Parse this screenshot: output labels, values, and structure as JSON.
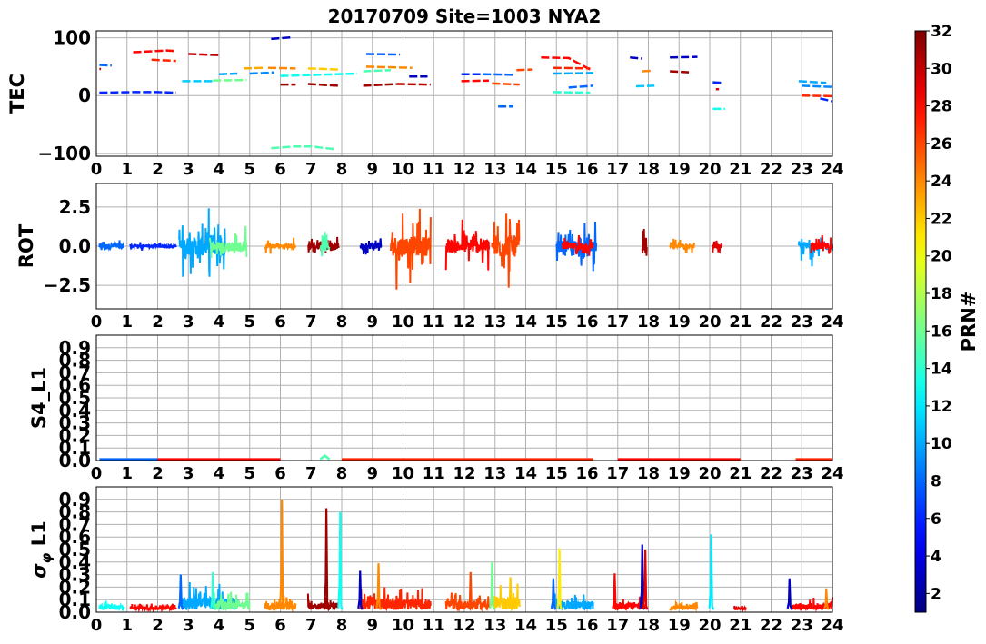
{
  "title": "20170709 Site=1003 NYA2",
  "x_ticks": [
    "0",
    "1",
    "2",
    "3",
    "4",
    "5",
    "6",
    "7",
    "8",
    "9",
    "10",
    "11",
    "12",
    "13",
    "14",
    "15",
    "16",
    "17",
    "18",
    "19",
    "20",
    "21",
    "22",
    "23",
    "24"
  ],
  "colorbar": {
    "label": "PRN#",
    "range": [
      1,
      32
    ],
    "ticks": [
      "2",
      "4",
      "6",
      "8",
      "10",
      "12",
      "14",
      "16",
      "18",
      "20",
      "22",
      "24",
      "26",
      "28",
      "30",
      "32"
    ],
    "colormap": "jet"
  },
  "chart_data": [
    {
      "type": "line",
      "ylabel": "TEC",
      "xlim": [
        0,
        24
      ],
      "ylim": [
        -105,
        112
      ],
      "yticks": [
        "100",
        "0",
        "−100"
      ],
      "ytick_values": [
        100,
        0,
        -100
      ],
      "grid": true,
      "segments": [
        {
          "prn": 8,
          "x": [
            0.1,
            0.5
          ],
          "y": [
            53,
            52
          ]
        },
        {
          "prn": 6,
          "x": [
            0.1,
            1.2,
            2.0,
            2.6
          ],
          "y": [
            5,
            6,
            6,
            5
          ]
        },
        {
          "prn": 30,
          "x": [
            0.1,
            0.15
          ],
          "y": [
            46,
            46
          ]
        },
        {
          "prn": 28,
          "x": [
            1.2,
            2.3,
            2.6
          ],
          "y": [
            75,
            78,
            77
          ]
        },
        {
          "prn": 27,
          "x": [
            1.8,
            2.6
          ],
          "y": [
            62,
            60
          ]
        },
        {
          "prn": 30,
          "x": [
            3.0,
            4.0
          ],
          "y": [
            72,
            70
          ]
        },
        {
          "prn": 11,
          "x": [
            2.8,
            3.8
          ],
          "y": [
            25,
            25
          ]
        },
        {
          "prn": 16,
          "x": [
            3.8,
            4.9
          ],
          "y": [
            26,
            27
          ]
        },
        {
          "prn": 10,
          "x": [
            4.0,
            4.6
          ],
          "y": [
            37,
            38
          ]
        },
        {
          "prn": 23,
          "x": [
            4.8,
            5.5
          ],
          "y": [
            47,
            48
          ]
        },
        {
          "prn": 9,
          "x": [
            5.0,
            5.8
          ],
          "y": [
            38,
            40
          ]
        },
        {
          "prn": 24,
          "x": [
            5.6,
            6.5
          ],
          "y": [
            48,
            47
          ]
        },
        {
          "prn": 3,
          "x": [
            5.7,
            6.4
          ],
          "y": [
            98,
            101
          ]
        },
        {
          "prn": 15,
          "x": [
            5.7,
            6.5,
            7.0,
            7.8
          ],
          "y": [
            -91,
            -88,
            -88,
            -93
          ]
        },
        {
          "prn": 31,
          "x": [
            6.0,
            6.5
          ],
          "y": [
            19,
            19
          ]
        },
        {
          "prn": 22,
          "x": [
            6.9,
            7.9
          ],
          "y": [
            47,
            45
          ]
        },
        {
          "prn": 31,
          "x": [
            6.9,
            7.9
          ],
          "y": [
            20,
            17
          ]
        },
        {
          "prn": 13,
          "x": [
            6.0,
            8.5
          ],
          "y": [
            34,
            38
          ]
        },
        {
          "prn": 8,
          "x": [
            8.8,
            9.9
          ],
          "y": [
            72,
            71
          ]
        },
        {
          "prn": 24,
          "x": [
            8.8,
            10.3
          ],
          "y": [
            50,
            48
          ]
        },
        {
          "prn": 15,
          "x": [
            8.7,
            9.6
          ],
          "y": [
            42,
            44
          ]
        },
        {
          "prn": 31,
          "x": [
            8.7,
            9.8
          ],
          "y": [
            17,
            20
          ]
        },
        {
          "prn": 30,
          "x": [
            9.8,
            10.9
          ],
          "y": [
            20,
            19
          ]
        },
        {
          "prn": 3,
          "x": [
            10.2,
            10.8
          ],
          "y": [
            33,
            33
          ]
        },
        {
          "prn": 6,
          "x": [
            11.9,
            12.7
          ],
          "y": [
            37,
            37
          ]
        },
        {
          "prn": 28,
          "x": [
            11.9,
            12.8
          ],
          "y": [
            25,
            26
          ]
        },
        {
          "prn": 26,
          "x": [
            12.9,
            13.8
          ],
          "y": [
            21,
            19
          ]
        },
        {
          "prn": 8,
          "x": [
            12.6,
            13.6
          ],
          "y": [
            37,
            36
          ]
        },
        {
          "prn": 8,
          "x": [
            13.1,
            13.6
          ],
          "y": [
            -19,
            -19
          ]
        },
        {
          "prn": 26,
          "x": [
            13.7,
            14.2
          ],
          "y": [
            44,
            45
          ]
        },
        {
          "prn": 28,
          "x": [
            14.5,
            15.4,
            16.1
          ],
          "y": [
            66,
            65,
            45
          ]
        },
        {
          "prn": 27,
          "x": [
            14.9,
            16.1
          ],
          "y": [
            48,
            47
          ]
        },
        {
          "prn": 10,
          "x": [
            14.9,
            16.2
          ],
          "y": [
            38,
            39
          ]
        },
        {
          "prn": 14,
          "x": [
            14.9,
            16.1
          ],
          "y": [
            6,
            5
          ]
        },
        {
          "prn": 8,
          "x": [
            15.4,
            16.2
          ],
          "y": [
            14,
            17
          ]
        },
        {
          "prn": 3,
          "x": [
            17.4,
            17.8
          ],
          "y": [
            66,
            64
          ]
        },
        {
          "prn": 24,
          "x": [
            17.8,
            18.1
          ],
          "y": [
            42,
            43
          ]
        },
        {
          "prn": 31,
          "x": [
            18.7,
            19.4
          ],
          "y": [
            42,
            40
          ]
        },
        {
          "prn": 3,
          "x": [
            18.7,
            19.6
          ],
          "y": [
            66,
            67
          ]
        },
        {
          "prn": 11,
          "x": [
            17.6,
            18.2
          ],
          "y": [
            16,
            17
          ]
        },
        {
          "prn": 6,
          "x": [
            20.1,
            20.4
          ],
          "y": [
            23,
            22
          ]
        },
        {
          "prn": 13,
          "x": [
            20.1,
            20.5
          ],
          "y": [
            -23,
            -23
          ]
        },
        {
          "prn": 29,
          "x": [
            20.2,
            20.3
          ],
          "y": [
            11,
            11
          ]
        },
        {
          "prn": 10,
          "x": [
            22.9,
            23.8
          ],
          "y": [
            25,
            22
          ]
        },
        {
          "prn": 9,
          "x": [
            23.0,
            24.0
          ],
          "y": [
            17,
            15
          ]
        },
        {
          "prn": 27,
          "x": [
            23.0,
            24.0
          ],
          "y": [
            0,
            -1
          ]
        },
        {
          "prn": 6,
          "x": [
            23.6,
            24.0
          ],
          "y": [
            -5,
            -10
          ]
        }
      ]
    },
    {
      "type": "line",
      "ylabel": "ROT",
      "xlim": [
        0,
        24
      ],
      "ylim": [
        -4,
        4
      ],
      "yticks": [
        "2.5",
        "0.0",
        "−2.5"
      ],
      "ytick_values": [
        2.5,
        0,
        -2.5
      ],
      "grid": true,
      "bursts": [
        {
          "prn": 8,
          "x0": 0.1,
          "x1": 0.9,
          "amp": 0.7
        },
        {
          "prn": 6,
          "x0": 1.1,
          "x1": 2.6,
          "amp": 0.3
        },
        {
          "prn": 10,
          "x0": 2.7,
          "x1": 4.2,
          "amp": 2.6
        },
        {
          "prn": 16,
          "x0": 3.7,
          "x1": 4.9,
          "amp": 1.4
        },
        {
          "prn": 24,
          "x0": 5.5,
          "x1": 6.5,
          "amp": 0.6
        },
        {
          "prn": 31,
          "x0": 6.9,
          "x1": 7.9,
          "amp": 0.8
        },
        {
          "prn": 15,
          "x0": 7.3,
          "x1": 7.6,
          "amp": 1.3
        },
        {
          "prn": 3,
          "x0": 8.6,
          "x1": 9.3,
          "amp": 0.8
        },
        {
          "prn": 26,
          "x0": 9.6,
          "x1": 10.9,
          "amp": 2.8
        },
        {
          "prn": 28,
          "x0": 11.4,
          "x1": 12.8,
          "amp": 1.9
        },
        {
          "prn": 26,
          "x0": 12.9,
          "x1": 13.8,
          "amp": 3.1
        },
        {
          "prn": 8,
          "x0": 15.0,
          "x1": 16.3,
          "amp": 1.6
        },
        {
          "prn": 28,
          "x0": 15.2,
          "x1": 16.2,
          "amp": 1.0
        },
        {
          "prn": 31,
          "x0": 17.8,
          "x1": 17.95,
          "amp": 2.5
        },
        {
          "prn": 24,
          "x0": 18.7,
          "x1": 19.5,
          "amp": 0.5
        },
        {
          "prn": 29,
          "x0": 20.1,
          "x1": 20.4,
          "amp": 0.4
        },
        {
          "prn": 10,
          "x0": 22.9,
          "x1": 24.0,
          "amp": 1.3
        },
        {
          "prn": 28,
          "x0": 23.3,
          "x1": 24.0,
          "amp": 1.0
        }
      ]
    },
    {
      "type": "line",
      "ylabel": "S4_L1",
      "xlim": [
        0,
        24
      ],
      "ylim": [
        0,
        1
      ],
      "yticks": [
        "0.9",
        "0.8",
        "0.7",
        "0.6",
        "0.5",
        "0.4",
        "0.3",
        "0.2",
        "0.1",
        "0.0"
      ],
      "ytick_values": [
        0.9,
        0.8,
        0.7,
        0.6,
        0.5,
        0.4,
        0.3,
        0.2,
        0.1,
        0.0
      ],
      "grid": true,
      "segments": [
        {
          "prn": 8,
          "x": [
            0.1,
            2.0
          ],
          "y": [
            0.01,
            0.01
          ]
        },
        {
          "prn": 28,
          "x": [
            2.0,
            6.0
          ],
          "y": [
            0.01,
            0.01
          ]
        },
        {
          "prn": 15,
          "x": [
            7.3,
            7.45,
            7.6
          ],
          "y": [
            0.01,
            0.04,
            0.01
          ]
        },
        {
          "prn": 27,
          "x": [
            8.0,
            16.2
          ],
          "y": [
            0.01,
            0.01
          ]
        },
        {
          "prn": 28,
          "x": [
            17.0,
            21.0
          ],
          "y": [
            0.01,
            0.01
          ]
        },
        {
          "prn": 27,
          "x": [
            22.8,
            24.0
          ],
          "y": [
            0.01,
            0.01
          ]
        }
      ]
    },
    {
      "type": "line",
      "ylabel": "σ_φ L1",
      "xlim": [
        0,
        24
      ],
      "ylim": [
        0,
        1
      ],
      "yticks": [
        "0.9",
        "0.8",
        "0.7",
        "0.6",
        "0.5",
        "0.4",
        "0.3",
        "0.2",
        "0.1",
        "0.0"
      ],
      "ytick_values": [
        0.9,
        0.8,
        0.7,
        0.6,
        0.5,
        0.4,
        0.3,
        0.2,
        0.1,
        0.0
      ],
      "grid": true,
      "bursts": [
        {
          "prn": 13,
          "x0": 0.1,
          "x1": 0.9,
          "amp": 0.08
        },
        {
          "prn": 28,
          "x0": 1.1,
          "x1": 2.6,
          "amp": 0.05
        },
        {
          "prn": 10,
          "x0": 2.7,
          "x1": 4.6,
          "amp": 0.22
        },
        {
          "prn": 16,
          "x0": 3.8,
          "x1": 5.0,
          "amp": 0.15
        },
        {
          "prn": 24,
          "x0": 5.5,
          "x1": 6.5,
          "amp": 0.12
        },
        {
          "prn": 31,
          "x0": 6.9,
          "x1": 7.9,
          "amp": 0.13
        },
        {
          "prn": 27,
          "x0": 8.6,
          "x1": 10.9,
          "amp": 0.18
        },
        {
          "prn": 26,
          "x0": 11.4,
          "x1": 12.8,
          "amp": 0.16
        },
        {
          "prn": 22,
          "x0": 12.9,
          "x1": 13.8,
          "amp": 0.22
        },
        {
          "prn": 10,
          "x0": 14.9,
          "x1": 16.2,
          "amp": 0.15
        },
        {
          "prn": 28,
          "x0": 16.9,
          "x1": 17.9,
          "amp": 0.12
        },
        {
          "prn": 24,
          "x0": 18.7,
          "x1": 19.6,
          "amp": 0.06
        },
        {
          "prn": 29,
          "x0": 20.8,
          "x1": 21.2,
          "amp": 0.04
        },
        {
          "prn": 28,
          "x0": 22.7,
          "x1": 24.0,
          "amp": 0.1
        }
      ],
      "spikes": [
        {
          "prn": 8,
          "x": 2.75,
          "y": 0.3
        },
        {
          "prn": 14,
          "x": 3.8,
          "y": 0.32
        },
        {
          "prn": 24,
          "x": 6.05,
          "y": 0.9
        },
        {
          "prn": 31,
          "x": 7.5,
          "y": 0.83
        },
        {
          "prn": 13,
          "x": 7.95,
          "y": 0.8
        },
        {
          "prn": 3,
          "x": 8.6,
          "y": 0.33
        },
        {
          "prn": 24,
          "x": 9.2,
          "y": 0.39
        },
        {
          "prn": 26,
          "x": 12.2,
          "y": 0.32
        },
        {
          "prn": 16,
          "x": 12.9,
          "y": 0.4
        },
        {
          "prn": 22,
          "x": 13.5,
          "y": 0.28
        },
        {
          "prn": 8,
          "x": 14.9,
          "y": 0.27
        },
        {
          "prn": 21,
          "x": 15.1,
          "y": 0.51
        },
        {
          "prn": 28,
          "x": 16.9,
          "y": 0.31
        },
        {
          "prn": 3,
          "x": 17.8,
          "y": 0.54
        },
        {
          "prn": 29,
          "x": 17.9,
          "y": 0.5
        },
        {
          "prn": 12,
          "x": 20.05,
          "y": 0.62
        },
        {
          "prn": 3,
          "x": 22.6,
          "y": 0.27
        },
        {
          "prn": 24,
          "x": 23.8,
          "y": 0.19
        }
      ]
    }
  ]
}
